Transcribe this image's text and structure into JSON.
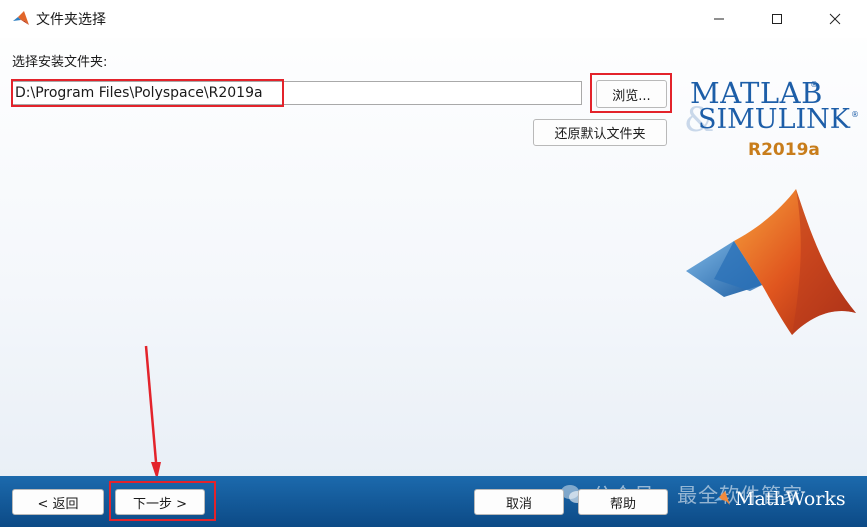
{
  "window": {
    "title": "文件夹选择",
    "controls": {
      "minimize": "minimize-icon",
      "maximize": "maximize-icon",
      "close": "close-icon"
    }
  },
  "folder": {
    "label": "选择安装文件夹:",
    "path_value": "D:\\Program Files\\Polyspace\\R2019a",
    "browse_label": "浏览...",
    "restore_label": "还原默认文件夹"
  },
  "branding": {
    "matlab": "MATLAB",
    "simulink": "SIMULINK",
    "ampersand": "&",
    "reg_mark": "®",
    "release": "R2019a",
    "mathworks": "MathWorks",
    "accent_color": "#1d5ea8",
    "release_color": "#c87d1b"
  },
  "footer": {
    "back_label": "< 返回",
    "next_label": "下一步 >",
    "cancel_label": "取消",
    "help_label": "帮助",
    "background_color": "#0c4a86"
  },
  "watermark": {
    "text": "公众号 · 最全软件管家"
  },
  "annotations": {
    "highlight_color": "#e3232b"
  }
}
